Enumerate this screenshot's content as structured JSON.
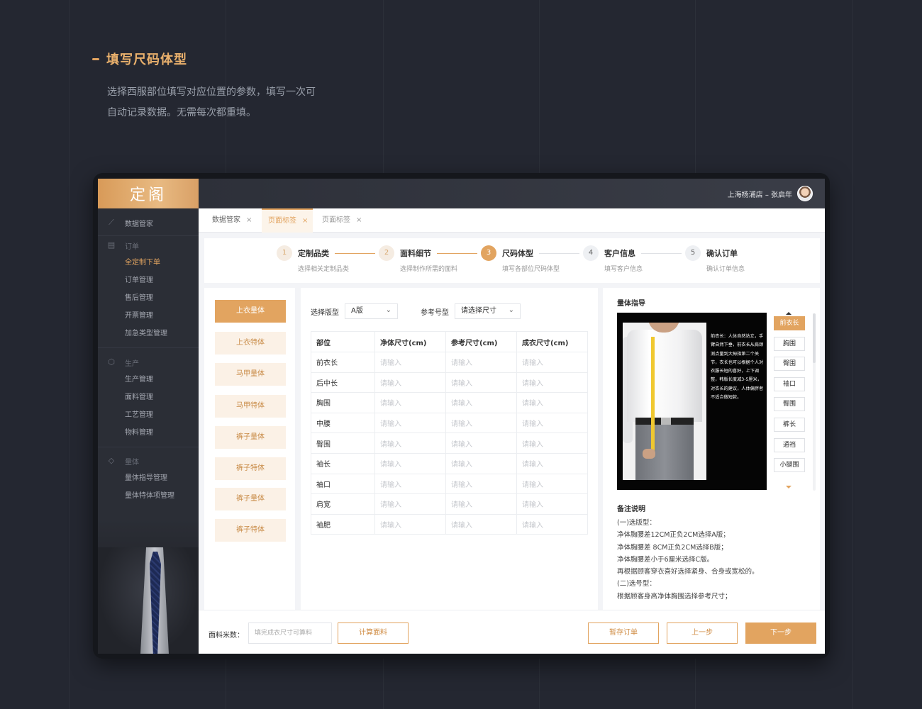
{
  "intro": {
    "heading": "填写尺码体型",
    "desc_line1": "选择西服部位填写对应位置的参数，填写一次可",
    "desc_line2": "自动记录数据。无需每次都重填。"
  },
  "app": {
    "logo": "定阁",
    "user": "上海杨浦店 – 张启年"
  },
  "sidebar": {
    "top_item": "数据管家",
    "group1": {
      "title": "订单",
      "items": [
        "全定制下单",
        "订单管理",
        "售后管理",
        "开票管理",
        "加急类型管理"
      ],
      "active": "全定制下单"
    },
    "group2": {
      "title": "生产",
      "items": [
        "生产管理",
        "面料管理",
        "工艺管理",
        "物料管理"
      ]
    },
    "group3": {
      "title": "量体",
      "items": [
        "量体指导管理",
        "量体特体项管理"
      ]
    }
  },
  "tabs": [
    {
      "label": "数据管家",
      "close": "×"
    },
    {
      "label": "页面标签",
      "close": "×"
    },
    {
      "label": "页面标签",
      "close": "×"
    }
  ],
  "steps": [
    {
      "num": "1",
      "title": "定制品类",
      "sub": "选择相关定制品类"
    },
    {
      "num": "2",
      "title": "面料细节",
      "sub": "选择制作所需的面料"
    },
    {
      "num": "3",
      "title": "尺码体型",
      "sub": "填写各部位尺码体型"
    },
    {
      "num": "4",
      "title": "客户信息",
      "sub": "填写客户信息"
    },
    {
      "num": "5",
      "title": "确认订单",
      "sub": "确认订单信息"
    }
  ],
  "left_panel": {
    "buttons": [
      "上衣量体",
      "上衣特体",
      "马甲量体",
      "马甲特体",
      "裤子量体",
      "裤子特体",
      "裤子量体",
      "裤子特体"
    ]
  },
  "form": {
    "version_label": "选择版型",
    "version_value": "A版",
    "size_label": "参考号型",
    "size_value": "请选择尺寸",
    "columns": [
      "部位",
      "净体尺寸(cm)",
      "参考尺寸(cm)",
      "成衣尺寸(cm)"
    ],
    "rows": [
      "前衣长",
      "后中长",
      "胸围",
      "中腰",
      "臀围",
      "袖长",
      "袖口",
      "肩宽",
      "袖肥"
    ],
    "placeholder": "请输入"
  },
  "guide": {
    "title": "量体指导",
    "photo_text": "前衣长：人体自然站立，手臂自然下垂，前衣长从肩颈测点量到大拇指第二个关节，衣长也可以根据个人对衣服长短的喜好，上下调整，韩版长度减3-5厘米，对衣长的建议，人体偏胖者不适合做短款。",
    "parts": [
      "前衣长",
      "胸围",
      "臀围",
      "袖口",
      "臀围",
      "裤长",
      "通裆",
      "小腿围"
    ],
    "notes_title": "备注说明",
    "notes": [
      "(一)选版型：",
      "净体胸腰差12CM正负2CM选择A版；",
      "净体胸腰差 8CM正负2CM选择B版；",
      "净体胸腰差小于6厘米选择C版。",
      "再根据顾客穿衣喜好选择紧身、合身或宽松的。",
      "(二)选号型：",
      "根据顾客身高净体胸围选择参考尺寸；"
    ]
  },
  "bottom": {
    "fabric_label": "面料米数：",
    "fabric_placeholder": "填完成衣尺寸可算料",
    "calc_button": "计算面料",
    "save_button": "暂存订单",
    "prev_button": "上一步",
    "next_button": "下一步"
  },
  "colors": {
    "accent": "#e2a460",
    "dark_bg": "#242731",
    "sidebar": "#2b2e36"
  }
}
